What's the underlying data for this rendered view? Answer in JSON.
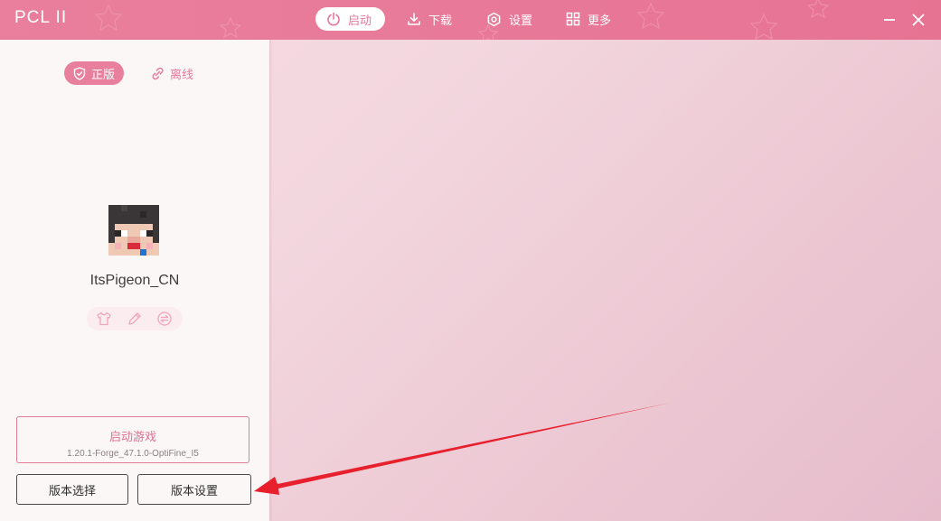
{
  "app": {
    "title": "PCL II"
  },
  "nav": {
    "items": [
      {
        "label": "启动",
        "icon": "power-icon",
        "active": true
      },
      {
        "label": "下载",
        "icon": "download-icon",
        "active": false
      },
      {
        "label": "设置",
        "icon": "settings-icon",
        "active": false
      },
      {
        "label": "更多",
        "icon": "grid-icon",
        "active": false
      }
    ]
  },
  "window_controls": {
    "minimize_icon": "minimize-icon",
    "close_icon": "close-icon"
  },
  "account": {
    "modes": [
      {
        "label": "正版",
        "icon": "shield-icon",
        "active": true
      },
      {
        "label": "离线",
        "icon": "link-icon",
        "active": false
      }
    ],
    "username": "ItsPigeon_CN",
    "skin_tools": [
      "shirt-icon",
      "pencil-icon",
      "swap-icon"
    ]
  },
  "launch": {
    "title": "启动游戏",
    "version": "1.20.1-Forge_47.1.0-OptiFine_I5"
  },
  "buttons": {
    "version_select": "版本选择",
    "version_settings": "版本设置"
  },
  "colors": {
    "accent": "#e8799a",
    "titlebar": "#e87999",
    "annotation_arrow": "#e8202e"
  }
}
